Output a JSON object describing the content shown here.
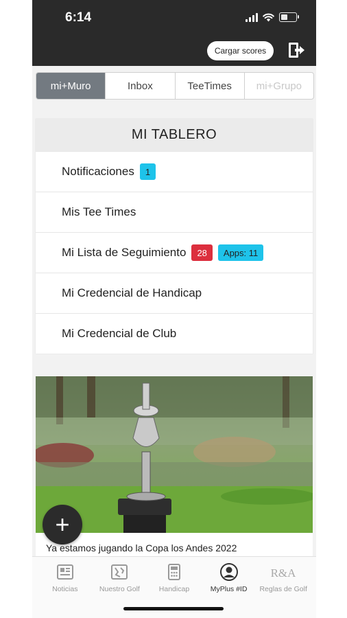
{
  "status_bar": {
    "time": "6:14"
  },
  "header": {
    "cargar_label": "Cargar scores"
  },
  "tabs": [
    {
      "label": "mi+Muro",
      "state": "active"
    },
    {
      "label": "Inbox",
      "state": "normal"
    },
    {
      "label": "TeeTimes",
      "state": "normal"
    },
    {
      "label": "mi+Grupo",
      "state": "disabled"
    }
  ],
  "board": {
    "title": "MI TABLERO",
    "items": [
      {
        "label": "Notificaciones",
        "badges": [
          {
            "text": "1",
            "color": "#1ec3ea"
          }
        ]
      },
      {
        "label": "Mis Tee Times",
        "badges": []
      },
      {
        "label": "Mi Lista de Seguimiento",
        "badges": [
          {
            "text": "28",
            "color": "#dc2f3e"
          },
          {
            "text": "Apps: 11",
            "color": "#1ec3ea"
          }
        ]
      },
      {
        "label": "Mi Credencial de Handicap",
        "badges": []
      },
      {
        "label": "Mi Credencial de Club",
        "badges": []
      }
    ]
  },
  "news": {
    "caption": "Ya estamos jugando la Copa los Andes 2022"
  },
  "fab": {
    "symbol": "+"
  },
  "bottom_nav": [
    {
      "label": "Noticias",
      "icon": "newspaper-icon",
      "active": false
    },
    {
      "label": "Nuestro Golf",
      "icon": "map-icon",
      "active": false
    },
    {
      "label": "Handicap",
      "icon": "calculator-icon",
      "active": false
    },
    {
      "label": "MyPlus #ID",
      "icon": "person-icon",
      "active": true
    },
    {
      "label": "Reglas de Golf",
      "icon": "randa-logo-icon",
      "active": false,
      "logo_text": "R&A"
    }
  ],
  "colors": {
    "header_bg": "#2a2a2a",
    "active_tab": "#737a81",
    "badge_blue": "#1ec3ea",
    "badge_red": "#dc2f3e"
  }
}
